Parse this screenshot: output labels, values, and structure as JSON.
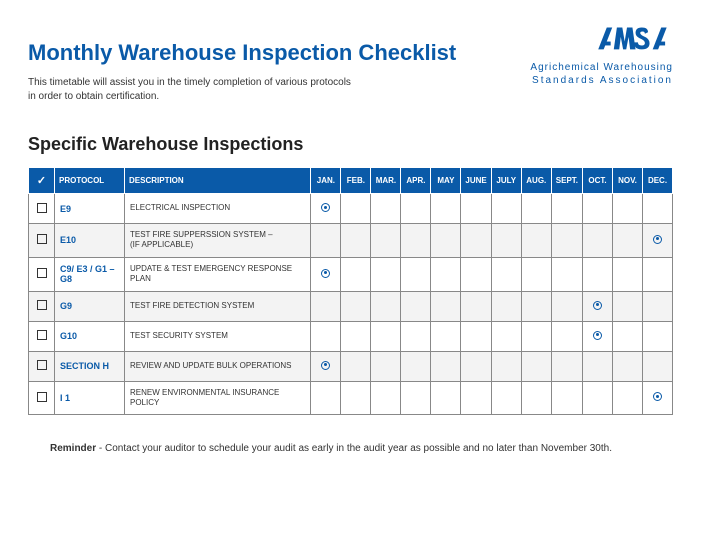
{
  "logo": {
    "line1": "Agrichemical Warehousing",
    "line2": "Standards Association"
  },
  "title": "Monthly Warehouse Inspection Checklist",
  "subtitle_line1": "This  timetable will assist you in the timely completion of various protocols",
  "subtitle_line2": "in order to obtain certification.",
  "section_title": "Specific Warehouse Inspections",
  "columns": {
    "protocol": "PROTOCOL",
    "description": "DESCRIPTION",
    "months": [
      "JAN.",
      "FEB.",
      "MAR.",
      "APR.",
      "MAY",
      "JUNE",
      "JULY",
      "AUG.",
      "SEPT.",
      "OCT.",
      "NOV.",
      "DEC."
    ]
  },
  "rows": [
    {
      "protocol": "E9",
      "description": "ELECTRICAL INSPECTION",
      "marks": [
        "JAN."
      ]
    },
    {
      "protocol": "E10",
      "description": "TEST  FIRE  SUPPERSSION SYSTEM – (IF APPLICABLE)",
      "marks": [
        "DEC."
      ]
    },
    {
      "protocol": "C9/ E3 / G1 –G8",
      "description": "UPDATE  & TEST EMERGENCY RESPONSE PLAN",
      "marks": [
        "JAN."
      ]
    },
    {
      "protocol": "G9",
      "description": "TEST FIRE DETECTION SYSTEM",
      "marks": [
        "OCT."
      ]
    },
    {
      "protocol": "G10",
      "description": "TEST SECURITY SYSTEM",
      "marks": [
        "OCT."
      ]
    },
    {
      "protocol": "SECTION H",
      "description": "REVIEW AND UPDATE BULK OPERATIONS",
      "marks": [
        "JAN."
      ]
    },
    {
      "protocol": "I 1",
      "description": "RENEW ENVIRONMENTAL INSURANCE POLICY",
      "marks": [
        "DEC."
      ]
    }
  ],
  "reminder_label": "Reminder",
  "reminder_text": " - Contact your auditor to schedule your audit as early in the audit year as possible and no later than November 30th."
}
